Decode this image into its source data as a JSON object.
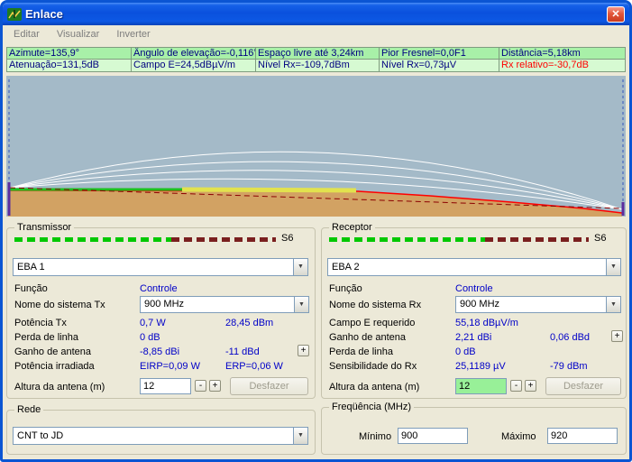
{
  "window": {
    "title": "Enlace"
  },
  "icons": {
    "close": "✕",
    "dropdown": "▼"
  },
  "menu": {
    "items": [
      "Editar",
      "Visualizar",
      "Inverter"
    ]
  },
  "status": {
    "row1": [
      "Azimute=135,9°",
      "Ângulo de elevação=-0,116°",
      "Espaço livre até 3,24km",
      "Pior Fresnel=0,0F1",
      "Distância=5,18km"
    ],
    "row2": [
      "Atenuação=131,5dB",
      "Campo E=24,5dBµV/m",
      "Nível Rx=-109,7dBm",
      "Nível Rx=0,73µV",
      "Rx relativo=-30,7dB"
    ]
  },
  "transmitter": {
    "group_label": "Transmissor",
    "signal_label": "S6",
    "unit": "EBA 1",
    "role_label": "Função",
    "role_value": "Controle",
    "system_label": "Nome do sistema Tx",
    "system_value": "900 MHz",
    "rows": [
      {
        "label": "Potência Tx",
        "v1": "0,7 W",
        "v2": "28,45 dBm"
      },
      {
        "label": "Perda de linha",
        "v1": "0 dB",
        "v2": ""
      },
      {
        "label": "Ganho de antena",
        "v1": "-8,85 dBi",
        "v2": "-11 dBd"
      },
      {
        "label": "Potência irradiada",
        "v1": "EIRP=0,09 W",
        "v2": "ERP=0,06 W"
      }
    ],
    "antenna_height_label": "Altura da antena (m)",
    "antenna_height_value": "12"
  },
  "receiver": {
    "group_label": "Receptor",
    "signal_label": "S6",
    "unit": "EBA 2",
    "role_label": "Função",
    "role_value": "Controle",
    "system_label": "Nome do sistema Rx",
    "system_value": "900 MHz",
    "rows": [
      {
        "label": "Campo E requerido",
        "v1": "55,18 dBµV/m",
        "v2": ""
      },
      {
        "label": "Ganho de antena",
        "v1": "2,21 dBi",
        "v2": "0,06 dBd"
      },
      {
        "label": "Perda de linha",
        "v1": "0 dB",
        "v2": ""
      },
      {
        "label": "Sensibilidade do Rx",
        "v1": "25,1189 µV",
        "v2": "-79 dBm"
      }
    ],
    "antenna_height_label": "Altura da antena (m)",
    "antenna_height_value": "12"
  },
  "controls": {
    "minus": "-",
    "plus": "+",
    "undo": "Desfazer"
  },
  "network": {
    "group_label": "Rede",
    "value": "CNT to JD"
  },
  "frequency": {
    "group_label": "Freqüência (MHz)",
    "min_label": "Mínimo",
    "min_value": "900",
    "max_label": "Máximo",
    "max_value": "920"
  },
  "colors": {
    "value-blue": "#0000c8",
    "status-green-1": "#a8f0a8",
    "status-green-2": "#d6fad2",
    "alert-red": "#ff0000",
    "changed-bg": "#98f098",
    "chart-sky": "#a4bac8",
    "terrain-tan": "#d2a263",
    "profile-red": "#ff0000",
    "bar-green": "#00c800",
    "bar-darkred": "#7a1f1f"
  }
}
